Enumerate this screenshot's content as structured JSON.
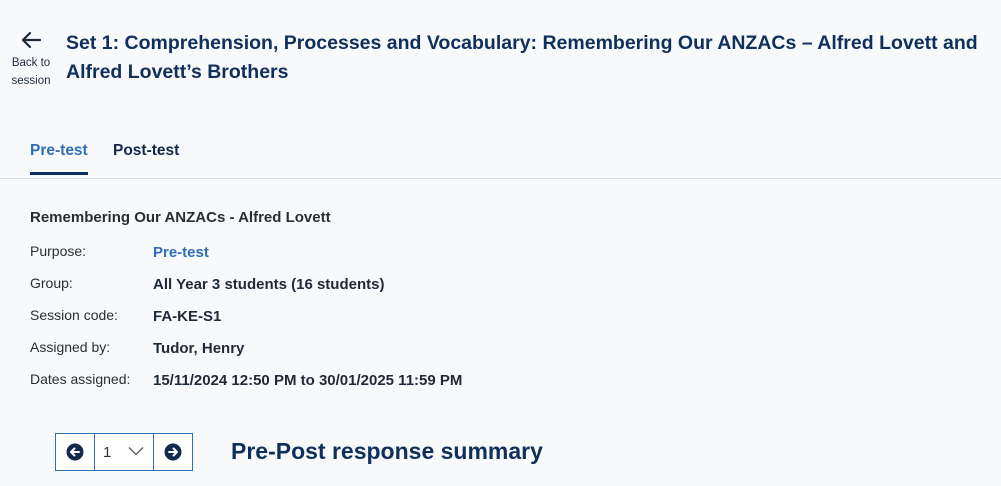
{
  "header": {
    "back_label": "Back to session",
    "title": "Set 1: Comprehension, Processes and Vocabulary: Remembering Our ANZACs – Alfred Lovett and Alfred Lovett’s Brothers"
  },
  "tabs": [
    {
      "label": "Pre-test",
      "active": true
    },
    {
      "label": "Post-test",
      "active": false
    }
  ],
  "session": {
    "title": "Remembering Our ANZACs - Alfred Lovett",
    "details": [
      {
        "label": "Purpose:",
        "value": "Pre-test"
      },
      {
        "label": "Group:",
        "value": "All Year 3 students (16 students)"
      },
      {
        "label": "Session code:",
        "value": "FA-KE-S1"
      },
      {
        "label": "Assigned by:",
        "value": "Tudor, Henry"
      },
      {
        "label": "Dates assigned:",
        "value": "15/11/2024 12:50 PM to 30/01/2025 11:59 PM"
      }
    ]
  },
  "pager": {
    "current": "1"
  },
  "summary": {
    "title": "Pre-Post response summary"
  },
  "colors": {
    "accent": "#2f6fb8",
    "heading": "#0f2f5c",
    "background": "#f8f9fa"
  },
  "icons": {
    "back": "arrow-left-icon",
    "prev": "circle-arrow-left-icon",
    "next": "circle-arrow-right-icon",
    "dropdown": "chevron-down-icon"
  }
}
